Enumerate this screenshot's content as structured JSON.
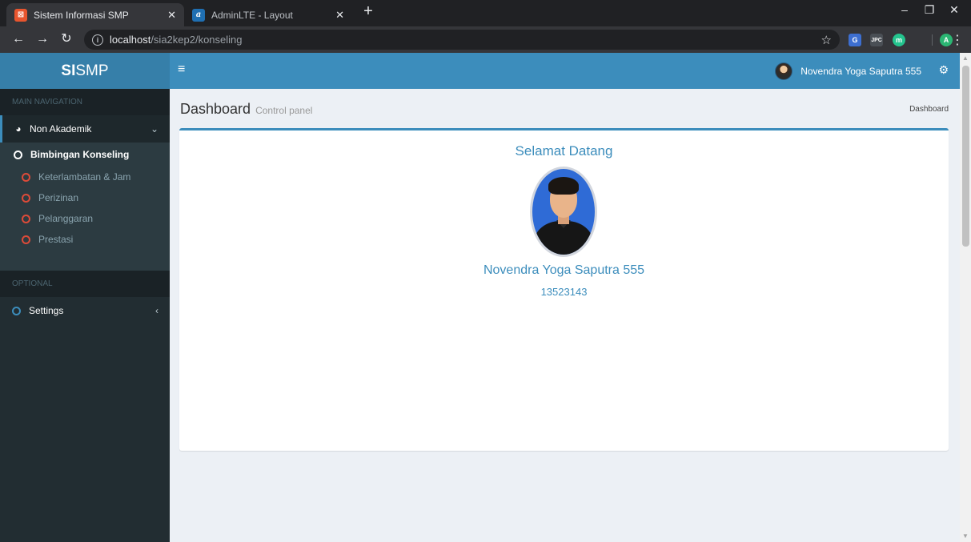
{
  "browser": {
    "tabs": [
      {
        "title": "Sistem Informasi SMP",
        "favicon": "xampp-icon",
        "active": true
      },
      {
        "title": "AdminLTE - Layout",
        "favicon": "adminlte-icon",
        "active": false
      }
    ],
    "url_host": "localhost",
    "url_path": "/sia2kep2/konseling",
    "profile_initial": "A",
    "extensions": {
      "ext_badge": "JPC",
      "ext_letter": "m"
    }
  },
  "app": {
    "logo_bold": "SI",
    "logo_rest": "SMP",
    "user_name": "Novendra Yoga Saputra 555",
    "accent_color": "#3c8dbc"
  },
  "sidebar": {
    "main_header": "MAIN NAVIGATION",
    "non_akademik": "Non Akademik",
    "bimbingan": "Bimbingan Konseling",
    "sub_items": [
      "Keterlambatan & Jam",
      "Perizinan",
      "Pelanggaran",
      "Prestasi"
    ],
    "optional_header": "OPTIONAL",
    "settings": "Settings"
  },
  "content": {
    "title": "Dashboard",
    "subtitle": "Control panel",
    "breadcrumb": "Dashboard",
    "welcome": "Selamat Datang",
    "name": "Novendra Yoga Saputra 555",
    "number": "13523143"
  }
}
